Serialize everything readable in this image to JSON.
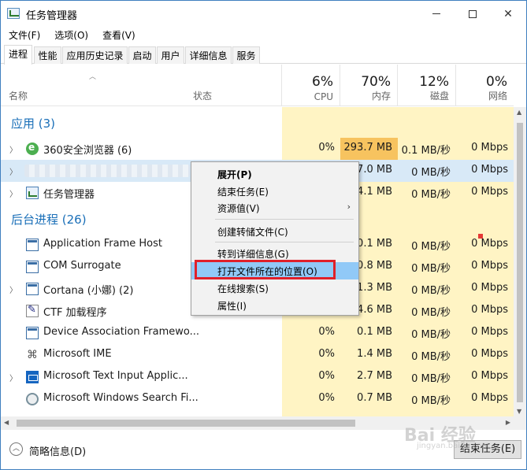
{
  "window": {
    "title": "任务管理器"
  },
  "menu": [
    "文件(F)",
    "选项(O)",
    "查看(V)"
  ],
  "tabs": [
    {
      "label": "进程",
      "active": true
    },
    {
      "label": "性能",
      "active": false
    },
    {
      "label": "应用历史记录",
      "active": false
    },
    {
      "label": "启动",
      "active": false
    },
    {
      "label": "用户",
      "active": false
    },
    {
      "label": "详细信息",
      "active": false
    },
    {
      "label": "服务",
      "active": false
    }
  ],
  "columns": {
    "name": "名称",
    "status": "状态",
    "cpu": {
      "percent": "6%",
      "label": "CPU"
    },
    "memory": {
      "percent": "70%",
      "label": "内存"
    },
    "disk": {
      "percent": "12%",
      "label": "磁盘"
    },
    "network": {
      "percent": "0%",
      "label": "网络"
    }
  },
  "groups": {
    "apps": "应用 (3)",
    "background": "后台进程 (26)"
  },
  "rows": [
    {
      "name": "360安全浏览器 (6)",
      "icon": "browser-360-icon",
      "expandable": true,
      "cpu": "0%",
      "mem": "293.7 MB",
      "disk": "0.1 MB/秒",
      "net": "0 Mbps"
    },
    {
      "name": "",
      "icon": "",
      "expandable": true,
      "cpu": "",
      "mem": "7.0 MB",
      "disk": "0 MB/秒",
      "net": "0 Mbps",
      "selected": true
    },
    {
      "name": "任务管理器",
      "icon": "task-manager-icon",
      "expandable": true,
      "cpu": "",
      "mem": "4.1 MB",
      "disk": "0 MB/秒",
      "net": "0 Mbps"
    },
    {
      "name": "Application Frame Host",
      "icon": "app-frame-icon",
      "expandable": false,
      "cpu": "",
      "mem": "0.1 MB",
      "disk": "0 MB/秒",
      "net": "0 Mbps"
    },
    {
      "name": "COM Surrogate",
      "icon": "com-surrogate-icon",
      "expandable": false,
      "cpu": "",
      "mem": "0.8 MB",
      "disk": "0 MB/秒",
      "net": "0 Mbps"
    },
    {
      "name": "Cortana (小娜) (2)",
      "icon": "cortana-icon",
      "expandable": true,
      "cpu": "",
      "mem": "1.3 MB",
      "disk": "0 MB/秒",
      "net": "0 Mbps"
    },
    {
      "name": "CTF 加载程序",
      "icon": "ctf-loader-icon",
      "expandable": false,
      "cpu": "",
      "mem": "4.6 MB",
      "disk": "0 MB/秒",
      "net": "0 Mbps"
    },
    {
      "name": "Device Association Framewo...",
      "icon": "device-association-icon",
      "expandable": false,
      "cpu": "0%",
      "mem": "0.1 MB",
      "disk": "0 MB/秒",
      "net": "0 Mbps"
    },
    {
      "name": "Microsoft IME",
      "icon": "ime-icon",
      "expandable": false,
      "cpu": "0%",
      "mem": "1.4 MB",
      "disk": "0 MB/秒",
      "net": "0 Mbps"
    },
    {
      "name": "Microsoft Text Input Applic...",
      "icon": "text-input-icon",
      "expandable": true,
      "cpu": "0%",
      "mem": "2.7 MB",
      "disk": "0 MB/秒",
      "net": "0 Mbps"
    },
    {
      "name": "Microsoft Windows Search Fi...",
      "icon": "windows-search-icon",
      "expandable": false,
      "cpu": "0%",
      "mem": "0.7 MB",
      "disk": "0 MB/秒",
      "net": "0 Mbps"
    }
  ],
  "context_menu": [
    {
      "label": "展开(P)",
      "bold": true
    },
    {
      "label": "结束任务(E)"
    },
    {
      "label": "资源值(V)",
      "submenu": true
    },
    {
      "label": "创建转储文件(C)"
    },
    {
      "label": "转到详细信息(G)"
    },
    {
      "label": "打开文件所在的位置(O)",
      "highlighted": true
    },
    {
      "label": "在线搜索(S)"
    },
    {
      "label": "属性(I)"
    }
  ],
  "footer": {
    "fewer_details": "简略信息(D)",
    "end_task": "结束任务(E)"
  },
  "watermark": {
    "main": "Bai 经验",
    "sub": "jingyan.baidu.com"
  },
  "colors": {
    "accent": "#1a6fb8",
    "heat_light": "#fff4c4",
    "heat_strong": "#f7c35f",
    "selection": "#91c9f7",
    "highlight_box": "#e0202a"
  }
}
